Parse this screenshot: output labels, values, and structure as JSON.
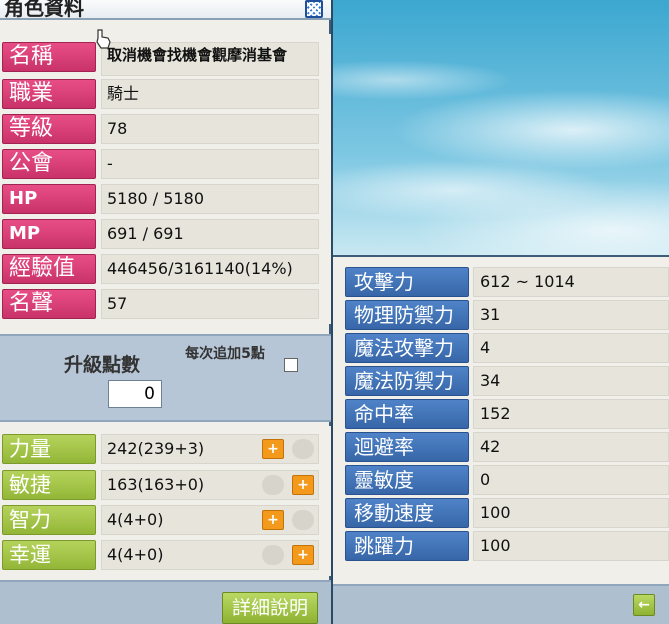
{
  "window": {
    "title": "角色資料"
  },
  "info": {
    "name_label": "名稱",
    "name_value": "取消機會找機會觀摩消基會",
    "job_label": "職業",
    "job_value": "騎士",
    "level_label": "等級",
    "level_value": "78",
    "guild_label": "公會",
    "guild_value": "-",
    "hp_label": "HP",
    "hp_value": "5180 / 5180",
    "mp_label": "MP",
    "mp_value": "691 / 691",
    "exp_label": "經驗值",
    "exp_value": "446456/3161140(14%)",
    "fame_label": "名聲",
    "fame_value": "57"
  },
  "ap": {
    "label": "升級點數",
    "value": "0",
    "auto_add_label": "每次追加5點",
    "auto_add_checked": false
  },
  "stats": {
    "str_label": "力量",
    "str_value": "242(239+3)",
    "dex_label": "敏捷",
    "dex_value": "163(163+0)",
    "int_label": "智力",
    "int_value": "4(4+0)",
    "luk_label": "幸運",
    "luk_value": "4(4+0)",
    "plus_icon": "+"
  },
  "buttons": {
    "detail_label": "詳細說明",
    "back_icon": "←"
  },
  "detail_stats": [
    {
      "label": "攻擊力",
      "value": "612 ~ 1014"
    },
    {
      "label": "物理防禦力",
      "value": "31"
    },
    {
      "label": "魔法攻擊力",
      "value": "4"
    },
    {
      "label": "魔法防禦力",
      "value": "34"
    },
    {
      "label": "命中率",
      "value": "152"
    },
    {
      "label": "迴避率",
      "value": "42"
    },
    {
      "label": "靈敏度",
      "value": "0"
    },
    {
      "label": "移動速度",
      "value": "100"
    },
    {
      "label": "跳躍力",
      "value": "100"
    }
  ],
  "colors": {
    "info_label": "#d83f78",
    "stat_label": "#a5c64a",
    "detail_label": "#4677bb",
    "plus_button": "#f39a1c"
  }
}
